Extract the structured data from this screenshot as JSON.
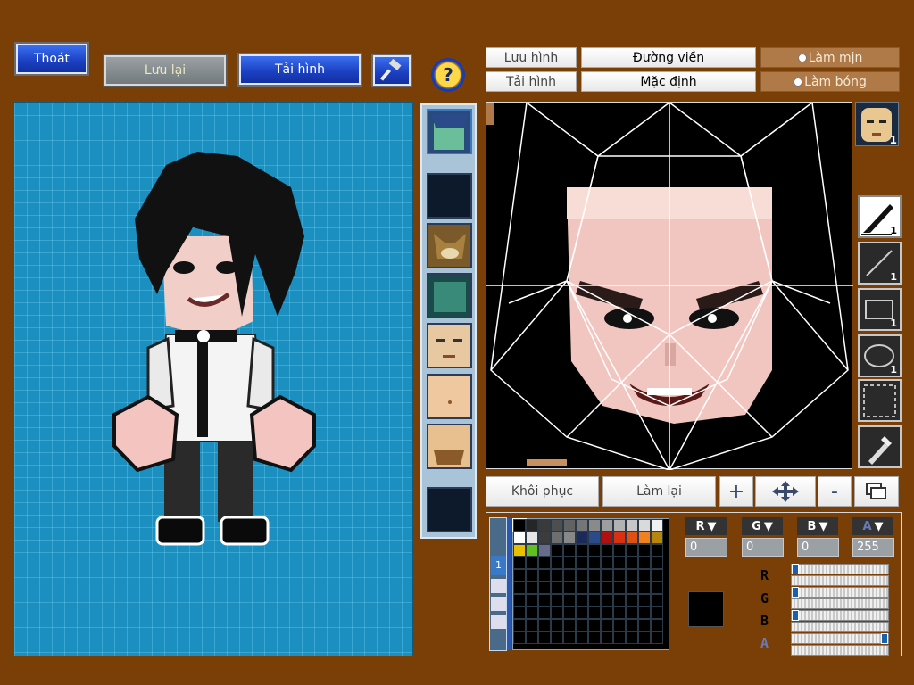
{
  "toolbar": {
    "exit_label": "Thoát",
    "save_label": "Lưu lại",
    "load_label": "Tải hình",
    "help_symbol": "?"
  },
  "editor_options": {
    "save_image_label": "Lưu hình",
    "load_image_label": "Tải hình",
    "outline_label": "Đường viền",
    "default_label": "Mặc định",
    "smooth_label": "Làm mịn",
    "shade_label": "Làm bóng"
  },
  "editor_actions": {
    "restore_label": "Khôi phục",
    "redo_label": "Làm lại",
    "zoom_in_symbol": "+",
    "zoom_out_symbol": "-"
  },
  "tools": [
    {
      "icon": "pen-icon",
      "count": "1"
    },
    {
      "icon": "line-icon",
      "count": "1"
    },
    {
      "icon": "rectangle-icon",
      "count": "1"
    },
    {
      "icon": "ellipse-icon",
      "count": "1"
    },
    {
      "icon": "selection-icon",
      "count": ""
    },
    {
      "icon": "eyedropper-icon",
      "count": ""
    }
  ],
  "face_preview_badge": "1",
  "color": {
    "r_label": "R",
    "g_label": "G",
    "b_label": "B",
    "a_label": "A",
    "r": "0",
    "g": "0",
    "b": "0",
    "a": "255",
    "r_fraction": 0,
    "g_fraction": 0,
    "b_fraction": 0,
    "a_fraction": 1,
    "current_hex": "#000000"
  },
  "palette_tab": "1",
  "palette_colors": [
    "#000000",
    "#262626",
    "#3a3a3a",
    "#4e4e4e",
    "#626262",
    "#767676",
    "#8a8a8a",
    "#9e9e9e",
    "#b2b2b2",
    "#c6c6c6",
    "#dadada",
    "#f0f0f0",
    "#ffffff",
    "#e6e6e6",
    "#3c3c3c",
    "#6e6e6e",
    "#888888",
    "#1a2a5a",
    "#2a4a8a",
    "#b01010",
    "#d83010",
    "#e05010",
    "#f08020",
    "#b8860b",
    "#e8c000",
    "#60c020",
    "#6a6a8a"
  ],
  "thumbnails": [
    {
      "name": "thumb-blue-hair-face",
      "selected": true
    },
    {
      "name": "thumb-empty-1"
    },
    {
      "name": "thumb-beast-face"
    },
    {
      "name": "thumb-green-mask-face"
    },
    {
      "name": "thumb-grumpy-face"
    },
    {
      "name": "thumb-plain-face"
    },
    {
      "name": "thumb-bearded-face"
    },
    {
      "name": "thumb-empty-2"
    }
  ]
}
